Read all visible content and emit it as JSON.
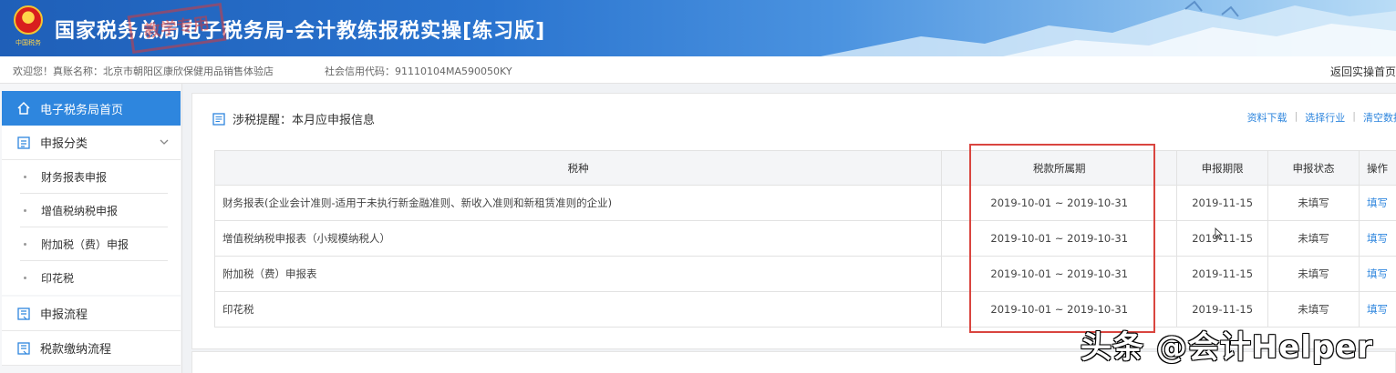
{
  "banner": {
    "title": "国家税务总局电子税务局-会计教练报税实操[练习版]",
    "stamp": "教学专用",
    "emblem_text": "中国税务"
  },
  "infobar": {
    "welcome_prefix": "欢迎您！真账名称：",
    "account_name": "北京市朝阳区康欣保健用品销售体验店",
    "credit_label": "社会信用代码：",
    "credit_code": "91110104MA590050KY",
    "back_link": "返回实操首页"
  },
  "sidebar": {
    "home": "电子税务局首页",
    "category": "申报分类",
    "sub_items": [
      "财务报表申报",
      "增值税纳税申报",
      "附加税（费）申报",
      "印花税"
    ],
    "flow": "申报流程",
    "payment": "税款缴纳流程"
  },
  "main": {
    "panel_title": "涉税提醒：本月应申报信息",
    "links": [
      "资料下载",
      "选择行业",
      "清空数据"
    ],
    "table": {
      "headers": [
        "税种",
        "税款所属期",
        "申报期限",
        "申报状态",
        "操作"
      ],
      "rows": [
        {
          "name": "财务报表(企业会计准则-适用于未执行新金融准则、新收入准则和新租赁准则的企业)",
          "period": "2019-10-01 ~ 2019-10-31",
          "deadline": "2019-11-15",
          "status": "未填写",
          "action": "填写"
        },
        {
          "name": "增值税纳税申报表（小规模纳税人）",
          "period": "2019-10-01 ~ 2019-10-31",
          "deadline": "2019-11-15",
          "status": "未填写",
          "action": "填写"
        },
        {
          "name": "附加税（费）申报表",
          "period": "2019-10-01 ~ 2019-10-31",
          "deadline": "2019-11-15",
          "status": "未填写",
          "action": "填写"
        },
        {
          "name": "印花税",
          "period": "2019-10-01 ~ 2019-10-31",
          "deadline": "2019-11-15",
          "status": "未填写",
          "action": "填写"
        }
      ]
    }
  },
  "watermark": "头条 @会计Helper",
  "colors": {
    "brand_blue": "#2e86de",
    "header_blue": "#1f5fb8",
    "highlight_red": "#d9453f"
  }
}
